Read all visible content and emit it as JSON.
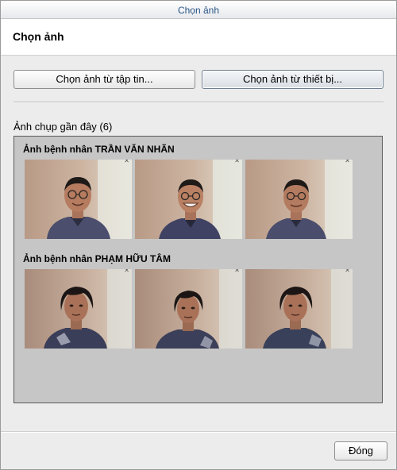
{
  "window": {
    "title": "Chọn ảnh"
  },
  "header": {
    "title": "Chọn ảnh"
  },
  "toolbar": {
    "from_file_label": "Chọn ảnh từ tập tin...",
    "from_device_label": "Chọn ảnh từ thiết bị..."
  },
  "recent": {
    "label": "Ảnh chụp gần đây (6)",
    "groups": [
      {
        "title": "Ảnh bệnh nhân TRẦN VĂN NHÃN",
        "photos": [
          "patient-photo",
          "patient-photo",
          "patient-photo"
        ]
      },
      {
        "title": "Ảnh bệnh nhân PHẠM HỮU TÂM",
        "photos": [
          "patient-photo",
          "patient-photo",
          "patient-photo"
        ]
      }
    ]
  },
  "footer": {
    "close_label": "Đóng"
  },
  "colors": {
    "gallery_bg": "#c6c6c6",
    "header_bg": "#ffffff",
    "dialog_bg": "#ececec",
    "title_text": "#2a5585"
  }
}
